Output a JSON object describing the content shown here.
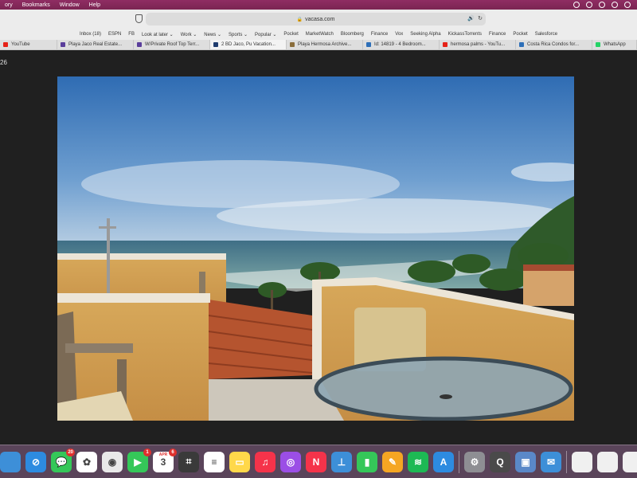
{
  "menubar": {
    "items": [
      "ory",
      "Bookmarks",
      "Window",
      "Help"
    ]
  },
  "toolbar": {
    "url": "vacasa.com"
  },
  "bookmarks": [
    "Inbox (18)",
    "ESPN",
    "FB",
    "Look at later ⌄",
    "Work ⌄",
    "News ⌄",
    "Sports ⌄",
    "Popular ⌄",
    "Pocket",
    "MarketWatch",
    "Bloomberg",
    "Finance",
    "Vox",
    "Seeking Alpha",
    "KickassTorrents",
    "Finance",
    "Pocket",
    "Salesforce"
  ],
  "tabs": [
    {
      "label": "YouTube",
      "color": "#e62117"
    },
    {
      "label": "Playa Jaco Real Estate...",
      "color": "#5a3e9b"
    },
    {
      "label": "W/Private Roof Top Terr...",
      "color": "#5a3e9b"
    },
    {
      "label": "2 BD Jaco, Pu Vacation...",
      "color": "#1f3c6e"
    },
    {
      "label": "Playa Hermosa Archive...",
      "color": "#8a6d3b"
    },
    {
      "label": "Id: 14819 - 4 Bedroom...",
      "color": "#2e6fb8"
    },
    {
      "label": "hermosa palms - YouTu...",
      "color": "#e62117"
    },
    {
      "label": "Costa Rica Condos for...",
      "color": "#2e6fb8"
    },
    {
      "label": "WhatsApp",
      "color": "#25d366"
    }
  ],
  "content": {
    "counter": "26"
  },
  "dock": {
    "apps": [
      {
        "name": "finder",
        "color": "#3d8fd8",
        "glyph": ""
      },
      {
        "name": "safari",
        "color": "#2d8be0",
        "glyph": "⊘"
      },
      {
        "name": "messages",
        "color": "#35c759",
        "glyph": "💬",
        "badge": "20"
      },
      {
        "name": "photos",
        "color": "#ffffff",
        "glyph": "✿"
      },
      {
        "name": "chrome",
        "color": "#e9e9e9",
        "glyph": "◉"
      },
      {
        "name": "facetime",
        "color": "#35c759",
        "glyph": "▶",
        "badge": "1"
      },
      {
        "name": "calendar",
        "color": "#ffffff",
        "glyph": "3",
        "badge": "6",
        "month": "APR"
      },
      {
        "name": "calculator",
        "color": "#3a3a3a",
        "glyph": "⌗"
      },
      {
        "name": "reminders",
        "color": "#ffffff",
        "glyph": "≡"
      },
      {
        "name": "notes",
        "color": "#ffd84a",
        "glyph": "▭"
      },
      {
        "name": "music",
        "color": "#f5334a",
        "glyph": "♫"
      },
      {
        "name": "podcasts",
        "color": "#9b4ee6",
        "glyph": "◎"
      },
      {
        "name": "news",
        "color": "#f5334a",
        "glyph": "N"
      },
      {
        "name": "keynote",
        "color": "#3d8fd8",
        "glyph": "⊥"
      },
      {
        "name": "numbers",
        "color": "#35c759",
        "glyph": "▮"
      },
      {
        "name": "pages",
        "color": "#f5a623",
        "glyph": "✎"
      },
      {
        "name": "spotify",
        "color": "#1db954",
        "glyph": "≋"
      },
      {
        "name": "app-store",
        "color": "#2d8be0",
        "glyph": "A"
      },
      {
        "name": "system-preferences",
        "color": "#8e8e93",
        "glyph": "⚙"
      },
      {
        "name": "quicktime",
        "color": "#4a4a4a",
        "glyph": "Q"
      },
      {
        "name": "preview",
        "color": "#5a88c8",
        "glyph": "▣"
      },
      {
        "name": "mail",
        "color": "#3d8fd8",
        "glyph": "✉"
      },
      {
        "name": "document-1",
        "color": "#f0f0f0",
        "glyph": ""
      },
      {
        "name": "document-2",
        "color": "#f0f0f0",
        "glyph": ""
      },
      {
        "name": "document-3",
        "color": "#f0f0f0",
        "glyph": ""
      }
    ]
  }
}
